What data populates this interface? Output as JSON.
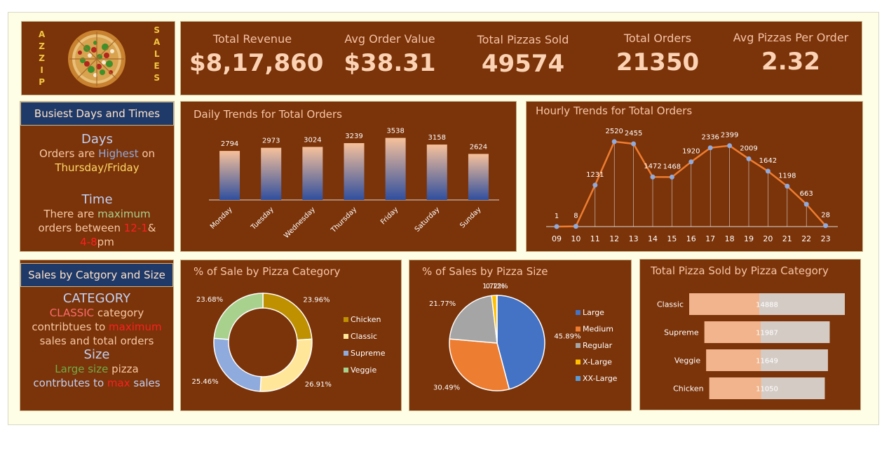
{
  "logo": {
    "left_letters": [
      "A",
      "Z",
      "Z",
      "I",
      "P"
    ],
    "right_letters": [
      "S",
      "A",
      "L",
      "E",
      "S"
    ]
  },
  "kpis": [
    {
      "label": "Total Revenue",
      "value": "$8,17,860"
    },
    {
      "label": "Avg Order Value",
      "value": "$38.31"
    },
    {
      "label": "Total Pizzas Sold",
      "value": "49574"
    },
    {
      "label": "Total Orders",
      "value": "21350"
    },
    {
      "label": "Avg Pizzas Per Order",
      "value": "2.32"
    }
  ],
  "busiest": {
    "header": "Busiest  Days and Times",
    "days_title": "Days",
    "days_line1_a": "Orders are ",
    "days_line1_b": "Highest",
    "days_line1_c": " on",
    "days_line2": "Thursday/Friday",
    "time_title": "Time",
    "time_line1_a": "There are ",
    "time_line1_b": "maximum",
    "time_line2_a": "orders between ",
    "time_line2_b": "12-1",
    "time_line2_c": "&",
    "time_line3_a": "4-8",
    "time_line3_b": "pm"
  },
  "category_note": {
    "header": "Sales by Catgory and Size",
    "cat_title": "CATEGORY",
    "cat_line1_a": "CLASSIC",
    "cat_line1_b": " category",
    "cat_line2_a": "contribtues to ",
    "cat_line2_b": "maximum",
    "cat_line3": "sales and total orders",
    "size_title": "Size",
    "size_line1_a": "Large size",
    "size_line1_b": " pizza",
    "size_line2_a": "contrbutes to ",
    "size_line2_b": "max",
    "size_line2_c": " sales"
  },
  "colors": {
    "panel": "#7b3309",
    "chicken": "#bf9000",
    "classic": "#ffe699",
    "supreme": "#8faadc",
    "veggie": "#a9d18e",
    "large": "#4472c4",
    "medium": "#ed7d31",
    "regular": "#a5a5a5",
    "xlarge": "#ffc000",
    "xxlarge": "#5b9bd5",
    "line": "#ed7d31",
    "marker": "#8faadc"
  },
  "chart_data": [
    {
      "type": "bar",
      "title": "Daily Trends for Total Orders",
      "categories": [
        "Monday",
        "Tuesday",
        "Wednesday",
        "Thursday",
        "Friday",
        "Saturday",
        "Sunday"
      ],
      "values": [
        2794,
        2973,
        3024,
        3239,
        3538,
        3158,
        2624
      ],
      "ylim": [
        0,
        4200
      ]
    },
    {
      "type": "line",
      "title": "Hourly Trends for Total Orders",
      "x": [
        "09",
        "10",
        "11",
        "12",
        "13",
        "14",
        "15",
        "16",
        "17",
        "18",
        "19",
        "20",
        "21",
        "22",
        "23"
      ],
      "values": [
        1,
        8,
        1231,
        2520,
        2455,
        1472,
        1468,
        1920,
        2336,
        2399,
        2009,
        1642,
        1198,
        663,
        28
      ],
      "ylim": [
        0,
        2600
      ]
    },
    {
      "type": "pie",
      "title": "% of Sale by Pizza Category",
      "labels": [
        "Chicken",
        "Classic",
        "Supreme",
        "Veggie"
      ],
      "values": [
        23.96,
        26.91,
        25.46,
        23.68
      ],
      "value_labels": [
        "23.96%",
        "26.91%",
        "25.46%",
        "23.68%"
      ]
    },
    {
      "type": "pie",
      "title": "% of Sales by Pizza Size",
      "labels": [
        "Large",
        "Medium",
        "Regular",
        "X-Large",
        "XX-Large"
      ],
      "values": [
        45.89,
        30.49,
        21.77,
        1.72,
        0.12
      ],
      "value_labels": [
        "45.89%",
        "30.49%",
        "21.77%",
        "1.72%",
        "0.12%"
      ]
    },
    {
      "type": "bar",
      "title": "Total Pizza Sold by Pizza Category",
      "categories": [
        "Classic",
        "Supreme",
        "Veggie",
        "Chicken"
      ],
      "values": [
        14888,
        11987,
        11649,
        11050
      ]
    }
  ]
}
